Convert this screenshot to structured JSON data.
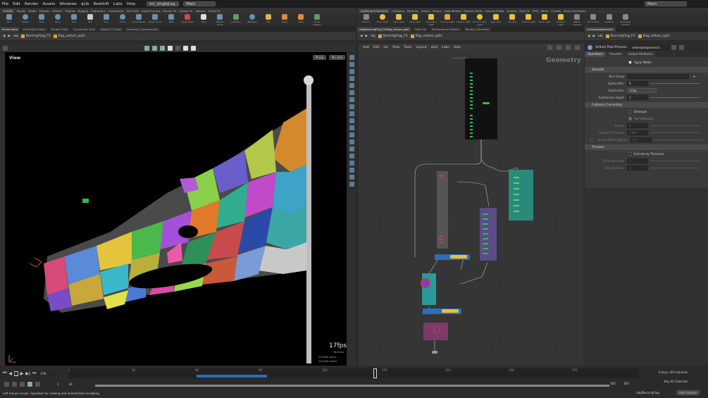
{
  "menubar": {
    "items": [
      "File",
      "Edit",
      "Render",
      "Assets",
      "Windows",
      "qLib",
      "Redshift",
      "Labs",
      "Help"
    ],
    "desktop_tab": "mr_singleLay...",
    "main_tab": "Main",
    "right_label": "Main"
  },
  "left_shelf": {
    "tabs": [
      "Create",
      "Modify",
      "Model",
      "Polygon",
      "Deform",
      "Texture",
      "Rigging",
      "Characters",
      "Constraints",
      "Hair Utils",
      "Guide Process",
      "Terrain FX",
      "Simple FX",
      "Volume",
      "Cloud FX"
    ],
    "tools": [
      "Box",
      "Sphere",
      "Tube",
      "Torus",
      "Grid",
      "Null",
      "Line",
      "Circle",
      "Curve Bezier",
      "Draw Curve",
      "Path",
      "Spray Paint",
      "Font",
      "Platonic Solids",
      "L-System",
      "Metaball",
      "File",
      "Spiral",
      "Helix",
      "Quick Shapes"
    ]
  },
  "right_shelf": {
    "tabs": [
      "Lights and Cameras",
      "Collisions",
      "Particles",
      "Grains",
      "Vellum",
      "Rigid Bodies",
      "Particle Fluids",
      "Viscous Fluids",
      "Oceans",
      "Pyro FX",
      "FEM",
      "Wires",
      "Crowds",
      "Drive Simulation"
    ],
    "tools": [
      "Camera",
      "Point Light",
      "Spot Light",
      "Area Light",
      "Geometry Light",
      "Volume Light",
      "Distant Light",
      "Environment Light",
      "Sky Light",
      "GI Light",
      "Caustic Light",
      "Portal Light",
      "Ambient Light",
      "Stereo Camera",
      "VR Camera",
      "Switcher",
      "Gamepad Camera"
    ]
  },
  "left_panes": {
    "tabs": [
      "Scene View",
      "Animation Editor",
      "Render View",
      "Composite View",
      "Motion FX View",
      "Geometry Spreadsheet"
    ],
    "path": [
      "obj",
      "BurningFlag_FX",
      "flag_vellum_split"
    ]
  },
  "viewport": {
    "label": "View",
    "camera_persp": "Persp",
    "camera_nocam": "No cam",
    "fps": "17fps",
    "fps_sub": "38.61ms",
    "stats": [
      "204,848  prims",
      "204,848  points"
    ]
  },
  "network": {
    "tabs": [
      "/obj/BurningFlag_FX/flag_vellum_split",
      "Take List",
      "Performance Monitor",
      "Render Scheduler"
    ],
    "path": [
      "obj",
      "BurningFlag_FX",
      "flag_vellum_split"
    ],
    "menu": [
      "Add",
      "Edit",
      "Go",
      "View",
      "Tools",
      "Layout",
      "qLib",
      "Labs",
      "Help"
    ],
    "context_label": "Geometry",
    "node_labels": [
      "indexfile",
      "vellumpostprocess1"
    ]
  },
  "params": {
    "tab_label": "vellumpostprocess1",
    "path": [
      "obj",
      "BurningFlag_FX",
      "flag_vellum_split"
    ],
    "node_type": "Vellum Post-Process",
    "node_name": "vellumpostprocess1",
    "tabs": [
      "Operations",
      "Visualize",
      "Output Attributes"
    ],
    "apply_welds": "Apply Welds",
    "sections": {
      "smooth": "Smooth",
      "collision": "Collision Correction",
      "thicken": "Thicken"
    },
    "smooth": {
      "blur_group_label": "Blur Group",
      "spatial_blur_label": "Spatial Blur",
      "spatial_blur": "0",
      "subdivision_label": "Subdivision",
      "subdivision": "Loop",
      "subdivision_depth_label": "Subdivision Depth",
      "subdivision_depth": "1"
    },
    "collision": {
      "detangle": "Detangle",
      "self_collisions": "Self Collisions",
      "passes_label": "Passes",
      "passes": "5",
      "default_thickness_label": "Default Thickness",
      "default_thickness": "0.001",
      "shape_match_label": "Shape Match Rigidity",
      "shape_match": "0.5"
    },
    "thicken": {
      "extrude": "Extrude by Thickness",
      "thickness_scale_label": "Thickness Scale",
      "thickness_scale": "1",
      "wire_divisions_label": "Wire Divisions",
      "wire_divisions": "4"
    }
  },
  "timeline": {
    "current_frame": "176",
    "ticks": [
      "1",
      "30",
      "60",
      "90",
      "120",
      "150",
      "176",
      "210",
      "240",
      "270"
    ],
    "start": "1",
    "start2": "30",
    "end": "300",
    "end2": "300",
    "status": "Left mouse scrubs. Spacebar for viewing and unrestricted scrubbing.",
    "keys_label": "0 keys, 0/0 channels",
    "key_all": "Key All Channels",
    "update_path": "/obj/BurningFlag",
    "auto_update": "Auto Update"
  }
}
